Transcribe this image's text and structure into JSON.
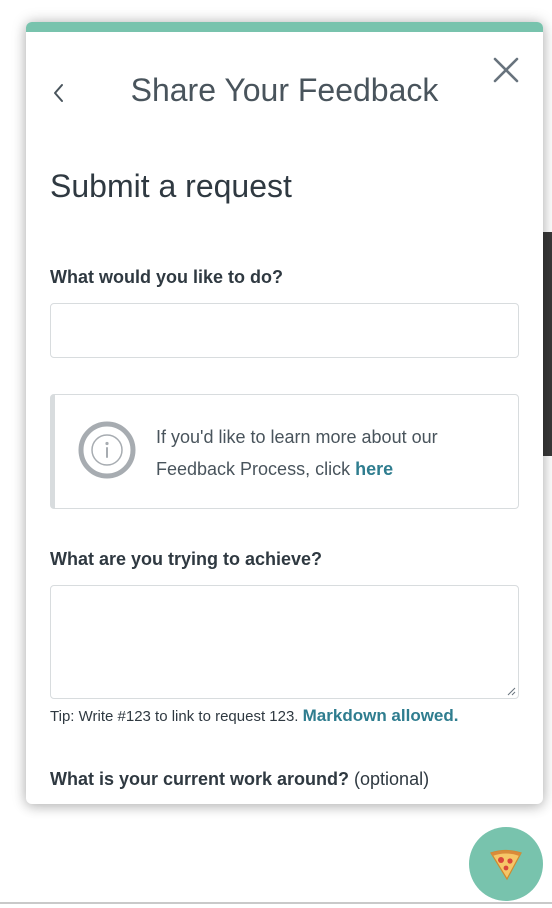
{
  "header": {
    "title": "Share Your Feedback"
  },
  "page": {
    "title": "Submit a request"
  },
  "form": {
    "q1_label": "What would you like to do?",
    "q1_value": "",
    "info_text": "If you'd like to learn more about our Feedback Process, click ",
    "info_link": "here",
    "q2_label": "What are you trying to achieve?",
    "q2_value": "",
    "tip_text": "Tip: Write #123 to link to request 123. ",
    "tip_link": "Markdown allowed.",
    "q3_label": "What is your current work around?",
    "q3_optional": " (optional)"
  },
  "icons": {
    "back": "chevron-left-icon",
    "close": "close-icon",
    "info": "info-circle-icon",
    "launcher": "pizza-icon"
  },
  "colors": {
    "accent": "#78c3ad",
    "link": "#2f7d8f",
    "text": "#2f3941",
    "border": "#d8dcde"
  }
}
